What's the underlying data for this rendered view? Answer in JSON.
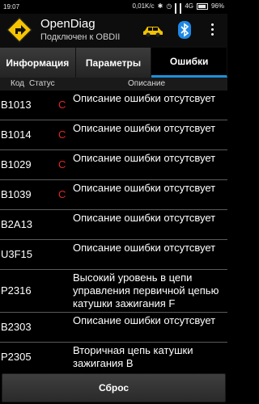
{
  "status_bar": {
    "time": "19:07",
    "speed": "0,01K/c",
    "network": "4G",
    "battery": "96%"
  },
  "app": {
    "title": "OpenDiag",
    "subtitle": "Подключен к OBDII",
    "icons": [
      "app-logo",
      "car-icon",
      "bluetooth-icon",
      "overflow-menu-icon"
    ],
    "colors": {
      "car": "#f2c200",
      "bluetooth": "#1e88e5",
      "accent": "#1e90d8",
      "status_error": "#e22626"
    }
  },
  "tabs": [
    {
      "label": "Информация",
      "active": false
    },
    {
      "label": "Параметры",
      "active": false
    },
    {
      "label": "Ошибки",
      "active": true
    }
  ],
  "columns": {
    "code": "Код",
    "status": "Статус",
    "description": "Описание"
  },
  "errors": [
    {
      "code": "B1013",
      "status": "C",
      "description": "Описание ошибки отсутсвует"
    },
    {
      "code": "B1014",
      "status": "C",
      "description": "Описание ошибки отсутсвует"
    },
    {
      "code": "B1029",
      "status": "C",
      "description": "Описание ошибки отсутсвует"
    },
    {
      "code": "B1039",
      "status": "C",
      "description": "Описание ошибки отсутсвует"
    },
    {
      "code": "B2A13",
      "status": "",
      "description": "Описание ошибки отсутсвует"
    },
    {
      "code": "U3F15",
      "status": "",
      "description": "Описание ошибки отсутсвует"
    },
    {
      "code": "P2316",
      "status": "",
      "description": "Высокий уровень в цепи управления первичной цепью катушки зажигания F"
    },
    {
      "code": "B2303",
      "status": "",
      "description": "Описание ошибки отсутсвует"
    },
    {
      "code": "P2305",
      "status": "",
      "description": "Вторичная цепь катушки зажигания B"
    }
  ],
  "reset_button": {
    "label": "Сброс"
  }
}
